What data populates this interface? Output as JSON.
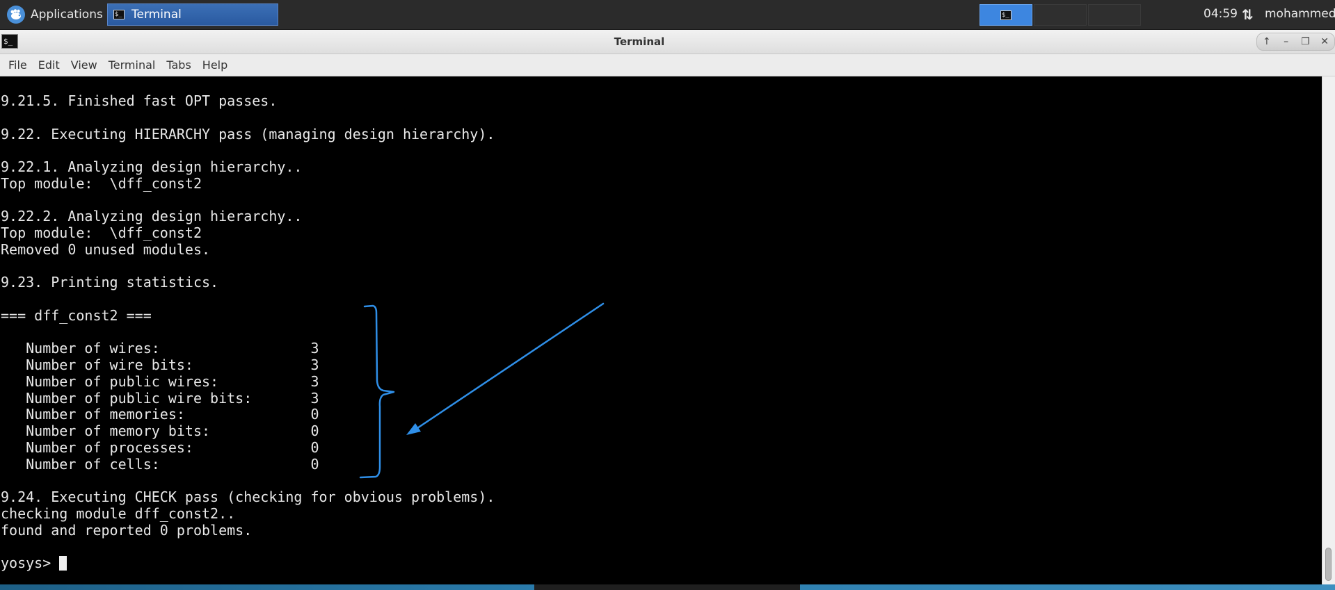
{
  "panel": {
    "apps_label": "Applications",
    "task_label": "Terminal",
    "task_icon_glyph": "$_",
    "workspace_icon_glyph": "$_",
    "clock": "04:59",
    "network_glyph": "⇅",
    "user": "mohammed"
  },
  "window": {
    "title": "Terminal",
    "icon_glyph": "$_",
    "controls": {
      "up": "↑",
      "minimize": "–",
      "maximize": "❐",
      "close": "✕"
    }
  },
  "menu": {
    "file": "File",
    "edit": "Edit",
    "view": "View",
    "terminal": "Terminal",
    "tabs": "Tabs",
    "help": "Help"
  },
  "terminal": {
    "lines": [
      "9.21.5. Finished fast OPT passes.",
      "",
      "9.22. Executing HIERARCHY pass (managing design hierarchy).",
      "",
      "9.22.1. Analyzing design hierarchy..",
      "Top module:  \\dff_const2",
      "",
      "9.22.2. Analyzing design hierarchy..",
      "Top module:  \\dff_const2",
      "Removed 0 unused modules.",
      "",
      "9.23. Printing statistics.",
      "",
      "=== dff_const2 ===",
      "",
      "   Number of wires:                  3",
      "   Number of wire bits:              3",
      "   Number of public wires:           3",
      "   Number of public wire bits:       3",
      "   Number of memories:               0",
      "   Number of memory bits:            0",
      "   Number of processes:              0",
      "   Number of cells:                  0",
      "",
      "9.24. Executing CHECK pass (checking for obvious problems).",
      "checking module dff_const2..",
      "found and reported 0 problems.",
      ""
    ],
    "prompt": "yosys> "
  },
  "colors": {
    "annotation": "#2f8fe8",
    "terminal_bg": "#000000",
    "terminal_fg": "#e8e8e8",
    "panel_bg": "#2b2b2b",
    "task_active": "#2a5aa0",
    "workspace_active": "#3d86e0"
  },
  "icons": {
    "apps": "xfce-mouse-icon",
    "task": "terminal-icon",
    "network": "network-updown-icon"
  }
}
